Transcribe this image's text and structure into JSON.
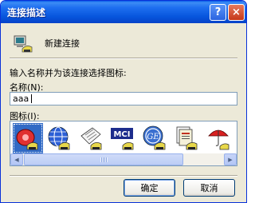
{
  "window": {
    "title": "连接描述",
    "help_glyph": "?",
    "close_glyph": "×"
  },
  "header": {
    "connection_label": "新建连接"
  },
  "form": {
    "prompt": "输入名称并为该连接选择图标:",
    "name_label": "名称(N):",
    "name_value": "aaa",
    "icon_label": "图标(I):"
  },
  "icons": [
    {
      "name": "red-phone-icon",
      "selected": true
    },
    {
      "name": "globe-phone-icon",
      "selected": false
    },
    {
      "name": "fax-phone-icon",
      "selected": false
    },
    {
      "name": "mci-phone-icon",
      "selected": false
    },
    {
      "name": "ge-phone-icon",
      "selected": false
    },
    {
      "name": "document-phone-icon",
      "selected": false
    },
    {
      "name": "umbrella-phone-icon",
      "selected": false
    }
  ],
  "buttons": {
    "ok_label": "确定",
    "cancel_label": "取消"
  },
  "colors": {
    "titlebar": "#0756dd",
    "selection": "#316ac5",
    "dialog_bg": "#ece9d8"
  }
}
